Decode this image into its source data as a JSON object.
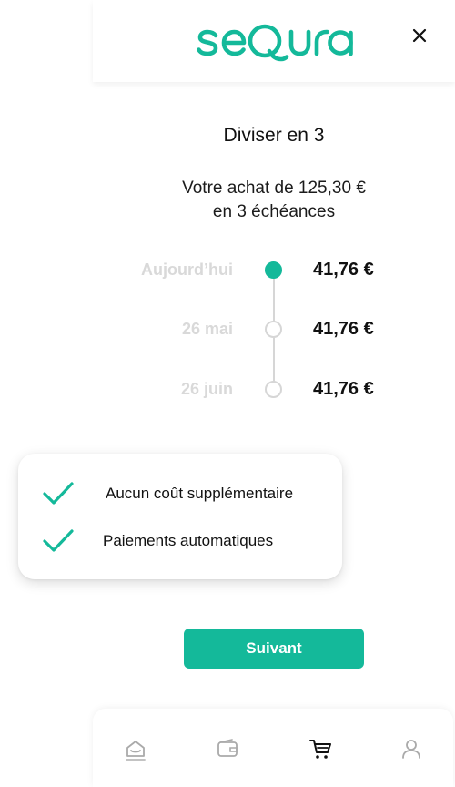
{
  "header": {
    "brand": "seQura",
    "close_icon": "close-icon"
  },
  "plan": {
    "title": "Diviser en 3",
    "subtitle_line1": "Votre achat de 125,30 €",
    "subtitle_line2": "en 3 échéances"
  },
  "installments": [
    {
      "date": "Aujourd’hui",
      "amount": "41,76 €",
      "status": "active"
    },
    {
      "date": "26 mai",
      "amount": "41,76 €",
      "status": "pending"
    },
    {
      "date": "26 juin",
      "amount": "41,76 €",
      "status": "pending"
    }
  ],
  "benefits": [
    {
      "icon": "check-icon",
      "label": "Aucun coût supplémentaire"
    },
    {
      "icon": "check-icon",
      "label": "Paiements automatiques"
    }
  ],
  "actions": {
    "next_label": "Suivant"
  },
  "nav": {
    "items": [
      {
        "icon": "home-icon"
      },
      {
        "icon": "wallet-icon"
      },
      {
        "icon": "cart-icon",
        "active": true
      },
      {
        "icon": "user-icon"
      }
    ]
  },
  "colors": {
    "accent": "#14b99a",
    "muted_text": "#d9d9d9",
    "timeline": "#d6d6d6"
  }
}
